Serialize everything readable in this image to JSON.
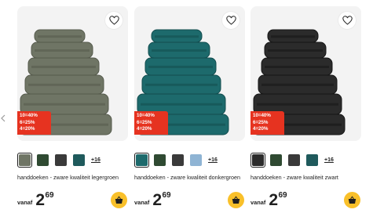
{
  "colors": {
    "promo_bg": "#e63320",
    "cart_bg": "#f9c02a",
    "photo_bg": "#f3f3f3",
    "text": "#1f1f1f"
  },
  "icons": {
    "favorite": "heart-outline-icon",
    "cart": "shopping-basket-icon",
    "nav": "chevron-left-icon"
  },
  "products": [
    {
      "title": "handdoeken - zware kwaliteit legergroen",
      "towel_color": "#6f7565",
      "towel_dark": "#555a4c",
      "promo": [
        "10=40%",
        "6=25%",
        "4=20%"
      ],
      "swatches": [
        "#6f7565",
        "#2f4a32",
        "#3a3a3a",
        "#1f5a5c"
      ],
      "selected_swatch": 0,
      "more_colors": "+16",
      "price_prefix": "vanaf",
      "price_int": "2",
      "price_dec": "69"
    },
    {
      "title": "handdoeken - zware kwaliteit donkergroen",
      "towel_color": "#1d6a6c",
      "towel_dark": "#124c4e",
      "promo": [
        "10=40%",
        "6=25%",
        "4=20%"
      ],
      "swatches": [
        "#1d6a6c",
        "#2f4a32",
        "#3a3a3a",
        "#8fb4d4"
      ],
      "selected_swatch": 0,
      "more_colors": "+16",
      "price_prefix": "vanaf",
      "price_int": "2",
      "price_dec": "69"
    },
    {
      "title": "handdoeken - zware kwaliteit zwart",
      "towel_color": "#2b2b2b",
      "towel_dark": "#161616",
      "promo": [
        "10=40%",
        "6=25%",
        "4=20%"
      ],
      "swatches": [
        "#2b2b2b",
        "#2f4a32",
        "#3a3a3a",
        "#1f5a5c"
      ],
      "selected_swatch": 0,
      "more_colors": "+16",
      "price_prefix": "vanaf",
      "price_int": "2",
      "price_dec": "69"
    }
  ]
}
